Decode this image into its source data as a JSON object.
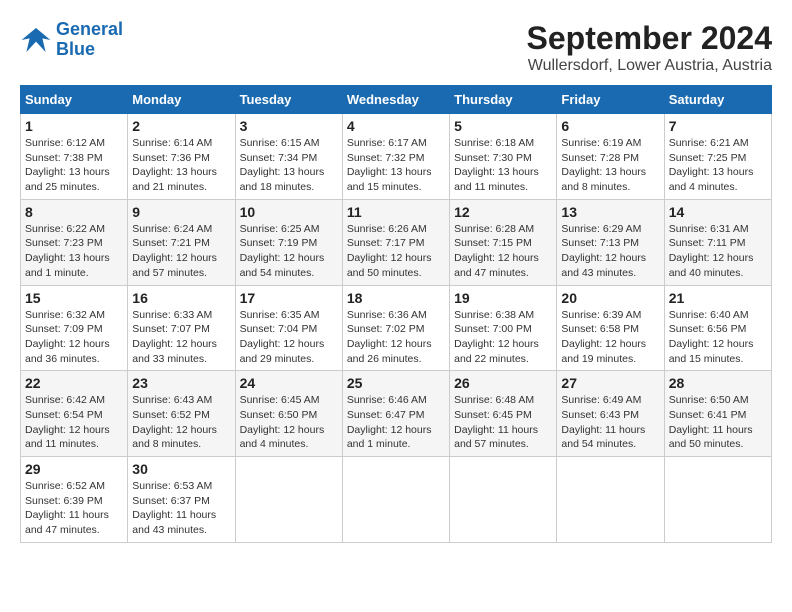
{
  "logo": {
    "line1": "General",
    "line2": "Blue"
  },
  "title": "September 2024",
  "subtitle": "Wullersdorf, Lower Austria, Austria",
  "days_of_week": [
    "Sunday",
    "Monday",
    "Tuesday",
    "Wednesday",
    "Thursday",
    "Friday",
    "Saturday"
  ],
  "weeks": [
    [
      {
        "day": "1",
        "info": "Sunrise: 6:12 AM\nSunset: 7:38 PM\nDaylight: 13 hours\nand 25 minutes."
      },
      {
        "day": "2",
        "info": "Sunrise: 6:14 AM\nSunset: 7:36 PM\nDaylight: 13 hours\nand 21 minutes."
      },
      {
        "day": "3",
        "info": "Sunrise: 6:15 AM\nSunset: 7:34 PM\nDaylight: 13 hours\nand 18 minutes."
      },
      {
        "day": "4",
        "info": "Sunrise: 6:17 AM\nSunset: 7:32 PM\nDaylight: 13 hours\nand 15 minutes."
      },
      {
        "day": "5",
        "info": "Sunrise: 6:18 AM\nSunset: 7:30 PM\nDaylight: 13 hours\nand 11 minutes."
      },
      {
        "day": "6",
        "info": "Sunrise: 6:19 AM\nSunset: 7:28 PM\nDaylight: 13 hours\nand 8 minutes."
      },
      {
        "day": "7",
        "info": "Sunrise: 6:21 AM\nSunset: 7:25 PM\nDaylight: 13 hours\nand 4 minutes."
      }
    ],
    [
      {
        "day": "8",
        "info": "Sunrise: 6:22 AM\nSunset: 7:23 PM\nDaylight: 13 hours\nand 1 minute."
      },
      {
        "day": "9",
        "info": "Sunrise: 6:24 AM\nSunset: 7:21 PM\nDaylight: 12 hours\nand 57 minutes."
      },
      {
        "day": "10",
        "info": "Sunrise: 6:25 AM\nSunset: 7:19 PM\nDaylight: 12 hours\nand 54 minutes."
      },
      {
        "day": "11",
        "info": "Sunrise: 6:26 AM\nSunset: 7:17 PM\nDaylight: 12 hours\nand 50 minutes."
      },
      {
        "day": "12",
        "info": "Sunrise: 6:28 AM\nSunset: 7:15 PM\nDaylight: 12 hours\nand 47 minutes."
      },
      {
        "day": "13",
        "info": "Sunrise: 6:29 AM\nSunset: 7:13 PM\nDaylight: 12 hours\nand 43 minutes."
      },
      {
        "day": "14",
        "info": "Sunrise: 6:31 AM\nSunset: 7:11 PM\nDaylight: 12 hours\nand 40 minutes."
      }
    ],
    [
      {
        "day": "15",
        "info": "Sunrise: 6:32 AM\nSunset: 7:09 PM\nDaylight: 12 hours\nand 36 minutes."
      },
      {
        "day": "16",
        "info": "Sunrise: 6:33 AM\nSunset: 7:07 PM\nDaylight: 12 hours\nand 33 minutes."
      },
      {
        "day": "17",
        "info": "Sunrise: 6:35 AM\nSunset: 7:04 PM\nDaylight: 12 hours\nand 29 minutes."
      },
      {
        "day": "18",
        "info": "Sunrise: 6:36 AM\nSunset: 7:02 PM\nDaylight: 12 hours\nand 26 minutes."
      },
      {
        "day": "19",
        "info": "Sunrise: 6:38 AM\nSunset: 7:00 PM\nDaylight: 12 hours\nand 22 minutes."
      },
      {
        "day": "20",
        "info": "Sunrise: 6:39 AM\nSunset: 6:58 PM\nDaylight: 12 hours\nand 19 minutes."
      },
      {
        "day": "21",
        "info": "Sunrise: 6:40 AM\nSunset: 6:56 PM\nDaylight: 12 hours\nand 15 minutes."
      }
    ],
    [
      {
        "day": "22",
        "info": "Sunrise: 6:42 AM\nSunset: 6:54 PM\nDaylight: 12 hours\nand 11 minutes."
      },
      {
        "day": "23",
        "info": "Sunrise: 6:43 AM\nSunset: 6:52 PM\nDaylight: 12 hours\nand 8 minutes."
      },
      {
        "day": "24",
        "info": "Sunrise: 6:45 AM\nSunset: 6:50 PM\nDaylight: 12 hours\nand 4 minutes."
      },
      {
        "day": "25",
        "info": "Sunrise: 6:46 AM\nSunset: 6:47 PM\nDaylight: 12 hours\nand 1 minute."
      },
      {
        "day": "26",
        "info": "Sunrise: 6:48 AM\nSunset: 6:45 PM\nDaylight: 11 hours\nand 57 minutes."
      },
      {
        "day": "27",
        "info": "Sunrise: 6:49 AM\nSunset: 6:43 PM\nDaylight: 11 hours\nand 54 minutes."
      },
      {
        "day": "28",
        "info": "Sunrise: 6:50 AM\nSunset: 6:41 PM\nDaylight: 11 hours\nand 50 minutes."
      }
    ],
    [
      {
        "day": "29",
        "info": "Sunrise: 6:52 AM\nSunset: 6:39 PM\nDaylight: 11 hours\nand 47 minutes."
      },
      {
        "day": "30",
        "info": "Sunrise: 6:53 AM\nSunset: 6:37 PM\nDaylight: 11 hours\nand 43 minutes."
      },
      null,
      null,
      null,
      null,
      null
    ]
  ]
}
